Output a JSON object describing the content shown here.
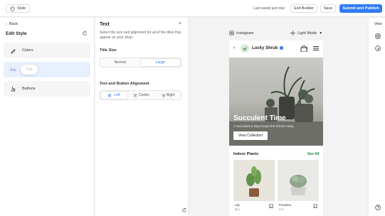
{
  "topbar": {
    "style_label": "Style",
    "saved_text": "Last saved just now",
    "exit_label": "Exit Builder",
    "save_label": "Save",
    "submit_label": "Submit and Publish",
    "accent": "#2f7bf5"
  },
  "left_panel": {
    "back_label": "Back",
    "title": "Edit Style",
    "items": [
      {
        "label": "Colors",
        "icon": "paint-brush-icon"
      },
      {
        "label": "",
        "icon": "text-aa-icon",
        "icon_text": "Aa",
        "tooltip": "Text"
      },
      {
        "label": "Buttons",
        "icon": "pointer-hand-icon"
      }
    ]
  },
  "text_panel": {
    "title": "Text",
    "description": "Select the size and alignment for all of the titles that appear on your shop.",
    "title_size_label": "Title Size",
    "sizes": [
      "Normal",
      "Large"
    ],
    "selected_size": "Large",
    "alignment_label": "Text and Button Alignment",
    "alignments": [
      "Left",
      "Center",
      "Right"
    ],
    "selected_alignment": "Left"
  },
  "preview": {
    "instagram_label": "Instagram",
    "mode_label": "Light Mode",
    "shop": {
      "brand": "Lucky Shrub",
      "cart_count": "0",
      "hero_title": "Succulent Time",
      "hero_subtitle": "A Succulent a Day Keeps the Doctor Away",
      "hero_button": "View Collection",
      "section_title": "Indoor Plants",
      "section_link": "See All",
      "products": [
        {
          "name": "Lily",
          "price": "$50"
        },
        {
          "name": "Pondera",
          "price": "$70"
        }
      ]
    }
  },
  "right_rail": {
    "label": "View"
  }
}
